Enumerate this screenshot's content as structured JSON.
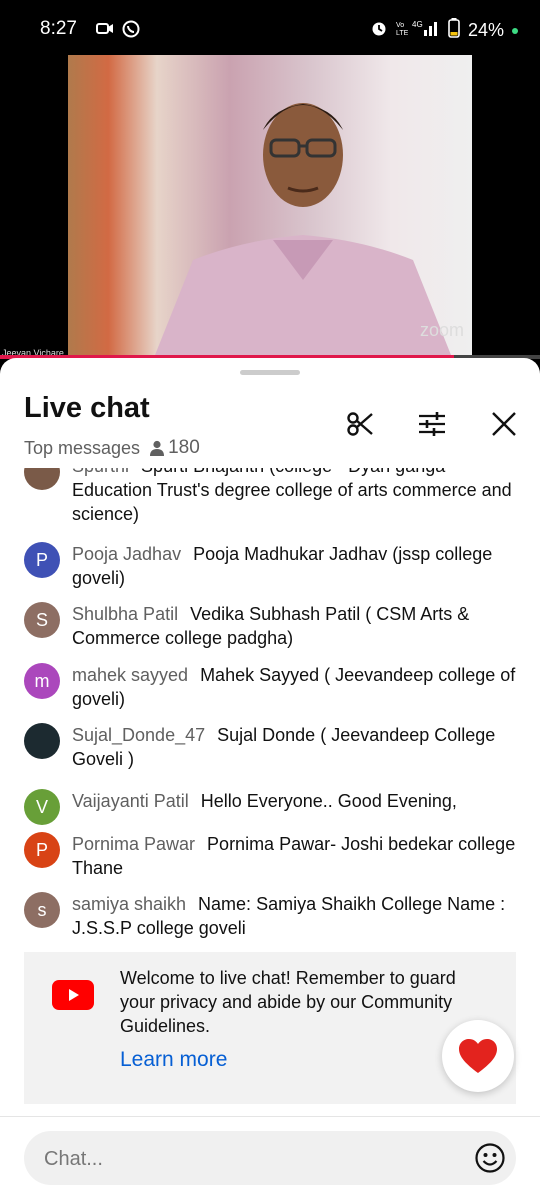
{
  "status": {
    "time": "8:27",
    "battery": "24%",
    "network": "4G"
  },
  "video": {
    "presenter_name": "Jeevan Vichare",
    "watermark": "zoom",
    "progress": 0.84
  },
  "chat": {
    "title": "Live chat",
    "filter": "Top messages",
    "viewer_count": "180",
    "messages": [
      {
        "author": "Spurthi",
        "text": "Spurti Bhajanth (college - Dyan ganga Education Trust's degree college of arts commerce and science)",
        "avatar_letter": "",
        "avatar_color": "#7a5a48"
      },
      {
        "author": "Pooja Jadhav",
        "text": "Pooja Madhukar Jadhav (jssp college goveli)",
        "avatar_letter": "P",
        "avatar_color": "#3f51b5"
      },
      {
        "author": "Shulbha Patil",
        "text": "Vedika Subhash Patil ( CSM Arts & Commerce college padgha)",
        "avatar_letter": "S",
        "avatar_color": "#8d6e63"
      },
      {
        "author": "mahek sayyed",
        "text": "Mahek Sayyed ( Jeevandeep college of goveli)",
        "avatar_letter": "m",
        "avatar_color": "#ab47bc"
      },
      {
        "author": "Sujal_Donde_47",
        "text": "Sujal Donde ( Jeevandeep College Goveli )",
        "avatar_letter": "",
        "avatar_color": "#1c2a30"
      },
      {
        "author": "Vaijayanti Patil",
        "text": "Hello Everyone.. Good Evening,",
        "avatar_letter": "V",
        "avatar_color": "#689f38"
      },
      {
        "author": "Pornima Pawar",
        "text": "Pornima Pawar- Joshi bedekar college Thane",
        "avatar_letter": "P",
        "avatar_color": "#d84315"
      },
      {
        "author": "samiya shaikh",
        "text": "Name: Samiya Shaikh College Name : J.S.S.P college goveli",
        "avatar_letter": "s",
        "avatar_color": "#8d6e63"
      }
    ],
    "welcome": {
      "text": "Welcome to live chat! Remember to guard your privacy and abide by our Community Guidelines.",
      "link": "Learn more"
    },
    "input_placeholder": "Chat..."
  },
  "colors": {
    "accent": "#e0184b",
    "link": "#065fd4",
    "youtube_red": "#ff0000"
  },
  "icons": [
    "camera-icon",
    "whatsapp-icon",
    "alarm-icon",
    "signal-icon",
    "battery-icon",
    "person-icon",
    "scissors-icon",
    "filter-icon",
    "close-icon",
    "youtube-icon",
    "heart-icon",
    "emoji-icon"
  ]
}
